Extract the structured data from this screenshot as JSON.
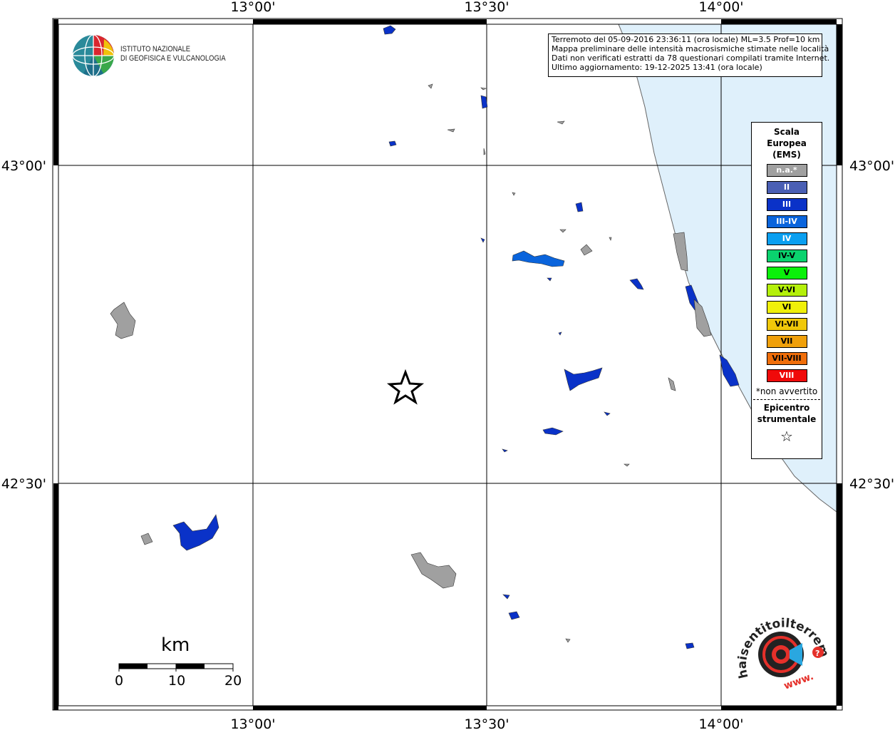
{
  "map": {
    "lon_ticks": [
      "13°00'",
      "13°30'",
      "14°00'"
    ],
    "lat_ticks": [
      "43°00'",
      "42°30'"
    ]
  },
  "info": {
    "line1": "Terremoto del 05-09-2016 23:36:11 (ora locale) ML=3.5 Prof=10 km",
    "line2": "Mappa preliminare delle intensità macrosismiche stimate nelle località",
    "line3": "Dati non verificati estratti da 78 questionari compilati tramite Internet.",
    "line4": "Ultimo aggiornamento: 19-12-2025 13:41 (ora locale)"
  },
  "legend": {
    "title": "Scala Europea (EMS)",
    "classes": [
      {
        "label": "n.a.*",
        "color": "#a0a0a0"
      },
      {
        "label": "II",
        "color": "#4a5fb4"
      },
      {
        "label": "III",
        "color": "#0a32c8"
      },
      {
        "label": "III-IV",
        "color": "#0a64dc"
      },
      {
        "label": "IV",
        "color": "#0a9ff0"
      },
      {
        "label": "IV-V",
        "color": "#0ad26e"
      },
      {
        "label": "V",
        "color": "#0af00a"
      },
      {
        "label": "V-VI",
        "color": "#b4f00a"
      },
      {
        "label": "VI",
        "color": "#f0f00a"
      },
      {
        "label": "VI-VII",
        "color": "#f0c80a"
      },
      {
        "label": "VII",
        "color": "#f0a00a"
      },
      {
        "label": "VII-VIII",
        "color": "#f06e0a"
      },
      {
        "label": "VIII",
        "color": "#f00a0a"
      }
    ],
    "note": "*non avvertito",
    "epicenter_label": "Epicentro strumentale",
    "epicenter_symbol": "☆"
  },
  "ingv": {
    "line1": "ISTITUTO NAZIONALE",
    "line2": "DI GEOFISICA E VULCANOLOGIA"
  },
  "scale": {
    "unit": "km",
    "labels": [
      "0",
      "10",
      "20"
    ]
  },
  "hst": {
    "text": "haisentitoilterremoto.it",
    "www": "www."
  }
}
